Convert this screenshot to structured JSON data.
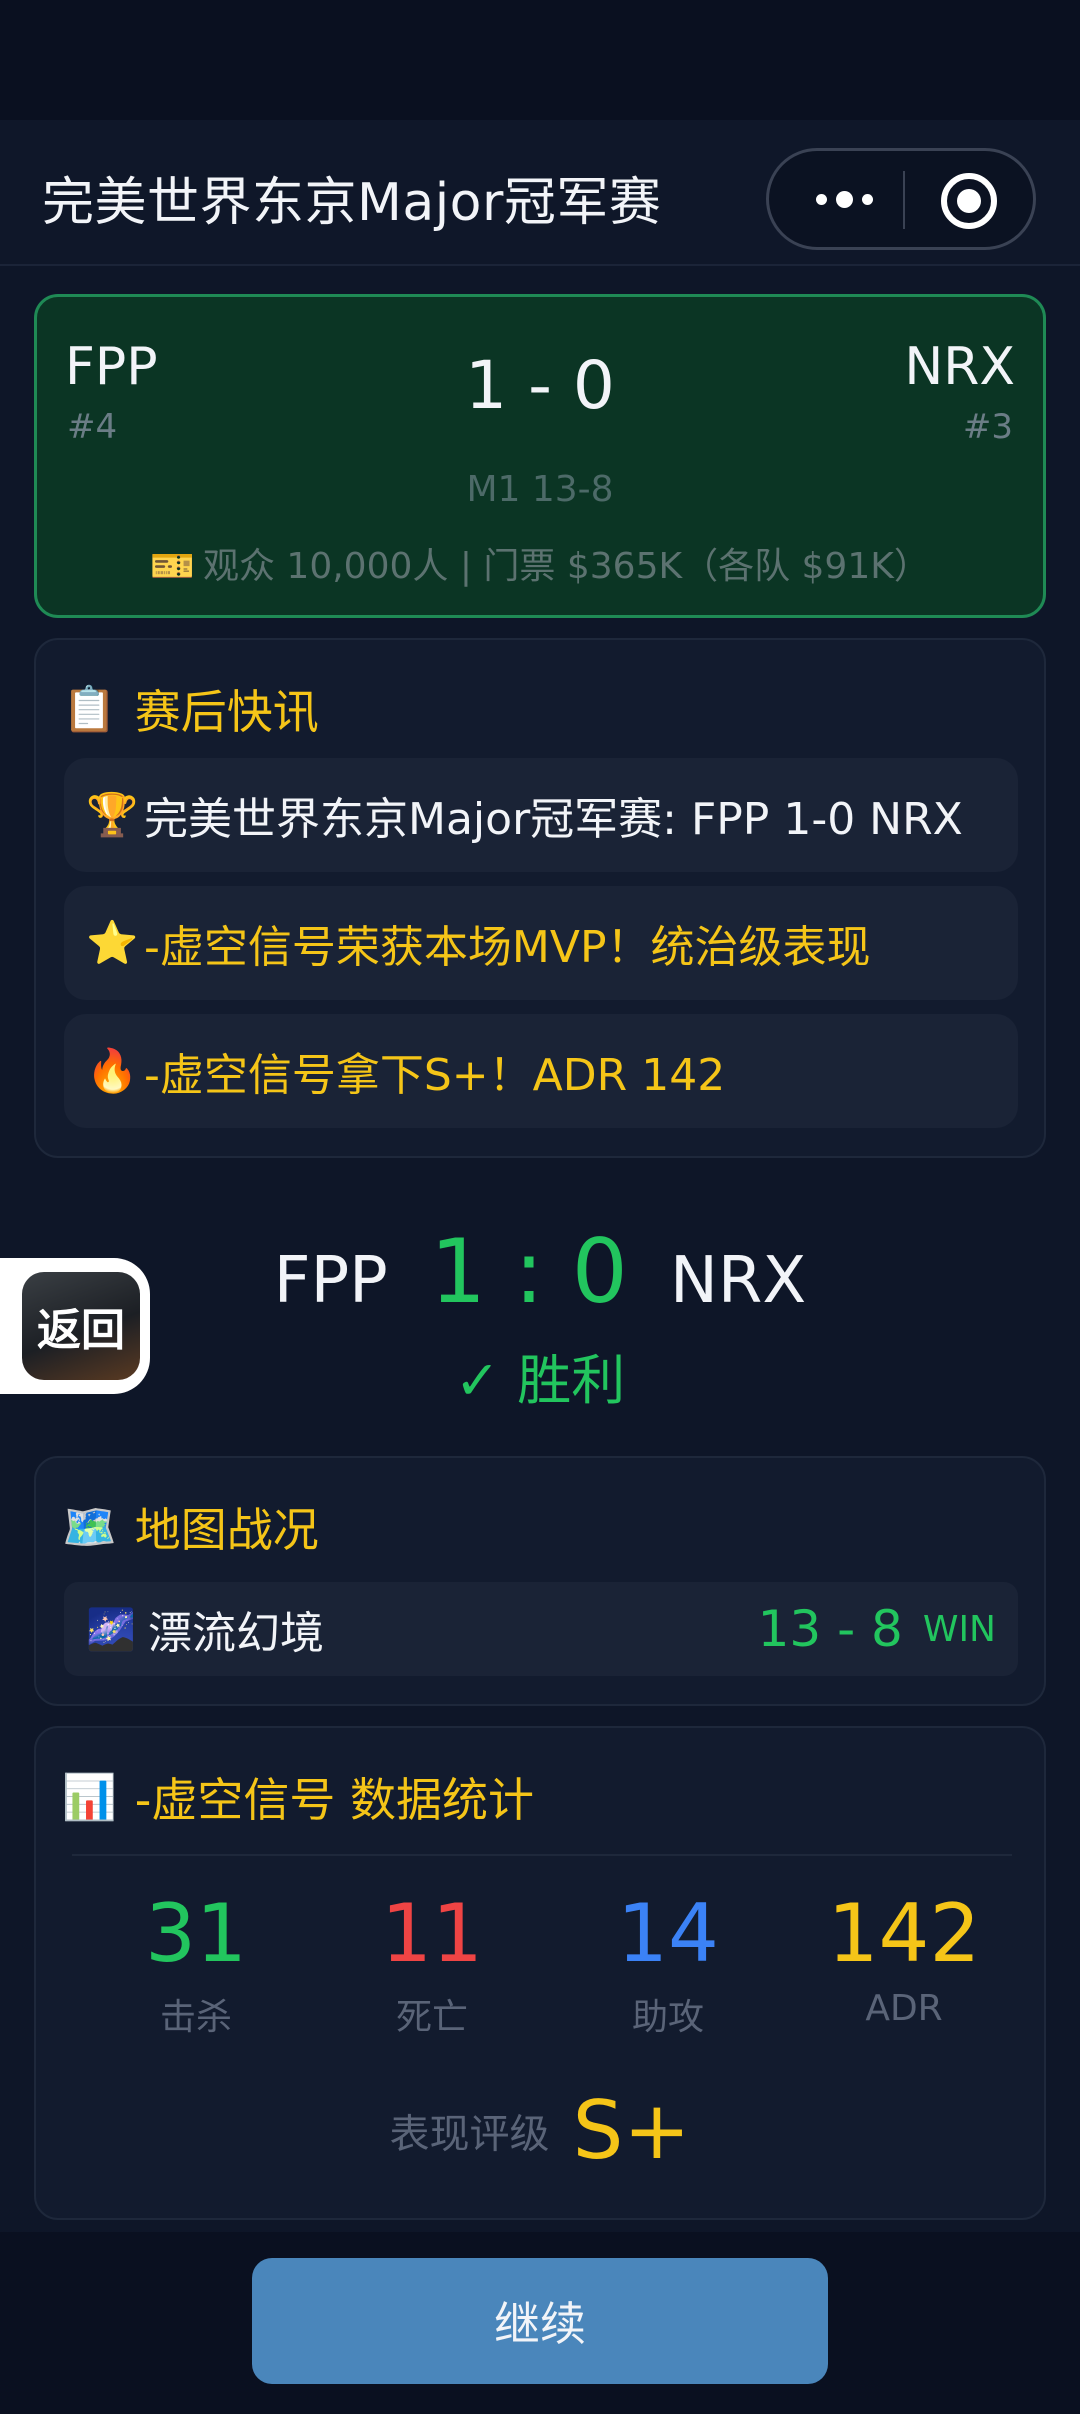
{
  "nav": {
    "title": "完美世界东京Major冠军赛"
  },
  "scoreboard": {
    "team_left": "FPP",
    "rank_left": "#4",
    "team_right": "NRX",
    "rank_right": "#3",
    "score": "1 - 0",
    "map_line": "M1 13-8",
    "audience_icon": "ticket-icon",
    "audience": "观众 10,000人 | 门票 $365K（各队 $91K）"
  },
  "news": {
    "title": "赛后快讯",
    "title_icon": "clipboard-icon",
    "items": [
      {
        "icon": "trophy-icon",
        "text": "完美世界东京Major冠军赛: FPP 1-0 NRX"
      },
      {
        "icon": "star-icon",
        "text": "-虚空信号荣获本场MVP！统治级表现"
      },
      {
        "icon": "fire-icon",
        "text": "-虚空信号拿下S+！ADR 142"
      }
    ]
  },
  "result": {
    "team_left": "FPP",
    "score": "1 : 0",
    "team_right": "NRX",
    "status": "✓ 胜利"
  },
  "back_button": {
    "label": "返回"
  },
  "maps": {
    "title": "地图战况",
    "title_icon": "map-icon",
    "rows": [
      {
        "icon": "galaxy-icon",
        "name": "漂流幻境",
        "score": "13 - 8",
        "result": "WIN"
      }
    ]
  },
  "stats": {
    "title": "-虚空信号 数据统计",
    "title_icon": "bar-chart-icon",
    "items": [
      {
        "value": "31",
        "label": "击杀",
        "color": "#22c55e"
      },
      {
        "value": "11",
        "label": "死亡",
        "color": "#ef4444"
      },
      {
        "value": "14",
        "label": "助攻",
        "color": "#3b82f6"
      },
      {
        "value": "142",
        "label": "ADR",
        "color": "#f5c518"
      }
    ],
    "grade_label": "表现评级",
    "grade": "S+"
  },
  "footer": {
    "continue_label": "继续"
  },
  "colors": {
    "accent_green": "#22c55e",
    "gold": "#f5c518",
    "button_blue": "#4a86bb"
  }
}
